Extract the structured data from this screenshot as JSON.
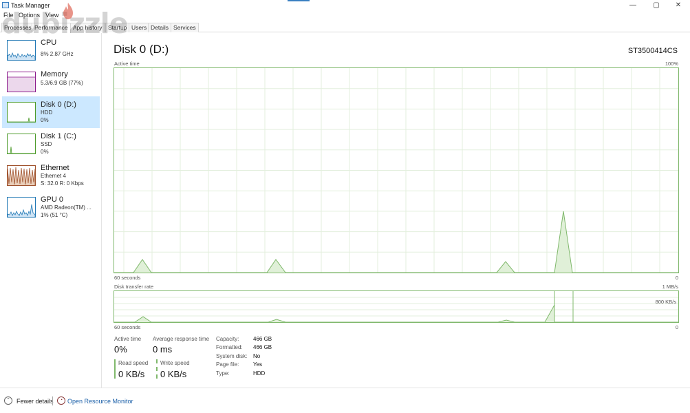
{
  "window": {
    "title": "Task Manager",
    "min": "—",
    "max": "▢",
    "close": "✕"
  },
  "menu": [
    "File",
    "Options",
    "View"
  ],
  "tabs": [
    "Processes",
    "Performance",
    "App history",
    "Startup",
    "Users",
    "Details",
    "Services"
  ],
  "watermark": "dubizzle",
  "sidebar": {
    "items": [
      {
        "name": "CPU",
        "line1": "8% 2.87 GHz",
        "line2": "",
        "color": "#1f77b4"
      },
      {
        "name": "Memory",
        "line1": "5.3/6.9 GB (77%)",
        "line2": "",
        "color": "#8b1a8b"
      },
      {
        "name": "Disk 0 (D:)",
        "line1": "HDD",
        "line2": "0%",
        "color": "#4c9a2a"
      },
      {
        "name": "Disk 1 (C:)",
        "line1": "SSD",
        "line2": "0%",
        "color": "#4c9a2a"
      },
      {
        "name": "Ethernet",
        "line1": "Ethernet 4",
        "line2": "S: 32.0 R: 0 Kbps",
        "color": "#a0522d"
      },
      {
        "name": "GPU 0",
        "line1": "AMD Radeon(TM) ...",
        "line2": "1% (51 °C)",
        "color": "#1f77b4"
      }
    ]
  },
  "main": {
    "title": "Disk 0 (D:)",
    "model": "ST3500414CS",
    "active_graph": {
      "label": "Active time",
      "max": "100%",
      "left_bottom": "60 seconds",
      "right_bottom": "0"
    },
    "transfer_graph": {
      "label": "Disk transfer rate",
      "max": "1 MB/s",
      "mid": "800 KB/s",
      "left_bottom": "60 seconds",
      "right_bottom": "0"
    }
  },
  "stats": {
    "active_time": {
      "label": "Active time",
      "value": "0%"
    },
    "avg_response": {
      "label": "Average response time",
      "value": "0 ms"
    },
    "read_speed": {
      "label": "Read speed",
      "value": "0 KB/s"
    },
    "write_speed": {
      "label": "Write speed",
      "value": "0 KB/s"
    },
    "details": [
      {
        "key": "Capacity:",
        "value": "466 GB"
      },
      {
        "key": "Formatted:",
        "value": "466 GB"
      },
      {
        "key": "System disk:",
        "value": "No"
      },
      {
        "key": "Page file:",
        "value": "Yes"
      },
      {
        "key": "Type:",
        "value": "HDD"
      }
    ]
  },
  "footer": {
    "fewer_details": "Fewer details",
    "resource_monitor": "Open Resource Monitor"
  },
  "colors": {
    "accent_green": "#7fb86b",
    "selected_bg": "#cce8ff",
    "link": "#1a5fa8"
  }
}
